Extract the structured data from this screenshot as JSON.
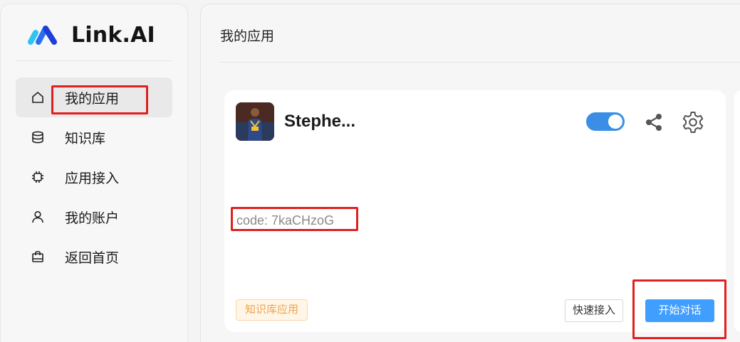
{
  "brand": {
    "name": "Link.AI",
    "mark_colors": [
      "#2ec4f0",
      "#2a6ff0",
      "#1d3fd6"
    ]
  },
  "sidebar": {
    "items": [
      {
        "label": "我的应用",
        "icon": "home-icon",
        "active": true,
        "highlighted": true
      },
      {
        "label": "知识库",
        "icon": "database-icon",
        "active": false
      },
      {
        "label": "应用接入",
        "icon": "chip-icon",
        "active": false
      },
      {
        "label": "我的账户",
        "icon": "user-icon",
        "active": false
      },
      {
        "label": "返回首页",
        "icon": "bag-icon",
        "active": false
      }
    ]
  },
  "main": {
    "title": "我的应用",
    "card": {
      "name": "Stephe...",
      "enabled": true,
      "code_text": "code: 7kaCHzoG",
      "tag": "知识库应用",
      "quick_button": "快速接入",
      "start_button": "开始对话"
    }
  },
  "colors": {
    "accent": "#409eff",
    "toggle_on": "#3a8ee6",
    "highlight_box": "#e02020",
    "tag_text": "#f0a24a",
    "tag_bg": "#fff6e8"
  }
}
